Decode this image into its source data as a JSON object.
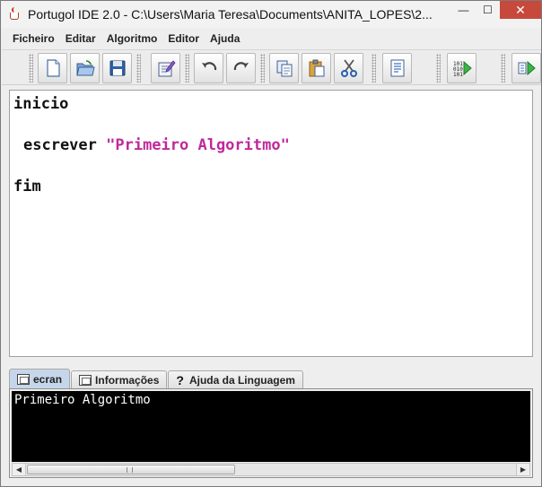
{
  "window": {
    "title": "Portugol IDE 2.0  - C:\\Users\\Maria Teresa\\Documents\\ANITA_LOPES\\2...",
    "minimize_glyph": "—",
    "maximize_glyph": "☐",
    "close_glyph": "✕"
  },
  "menu": [
    "Ficheiro",
    "Editar",
    "Algoritmo",
    "Editor",
    "Ajuda"
  ],
  "toolbar": {
    "buttons": [
      "new-file-icon",
      "open-folder-icon",
      "save-icon",
      "edit-document-icon",
      "undo-icon",
      "redo-icon",
      "copy-icon",
      "paste-icon",
      "cut-icon",
      "document-list-icon",
      "run-binary-icon",
      "run-step-icon"
    ]
  },
  "editor": {
    "lines": [
      "inicio",
      "escrever ",
      "fim"
    ],
    "string_literal": "\"Primeiro Algoritmo\"",
    "string_color": "#c0289a"
  },
  "tabs": [
    {
      "label": "ecran",
      "icon": "screen-icon",
      "active": true
    },
    {
      "label": "Informações",
      "icon": "info-console-icon",
      "active": false
    },
    {
      "label": "Ajuda da Linguagem",
      "icon": "help-icon",
      "active": false
    }
  ],
  "console": {
    "output": "Primeiro Algoritmo"
  }
}
